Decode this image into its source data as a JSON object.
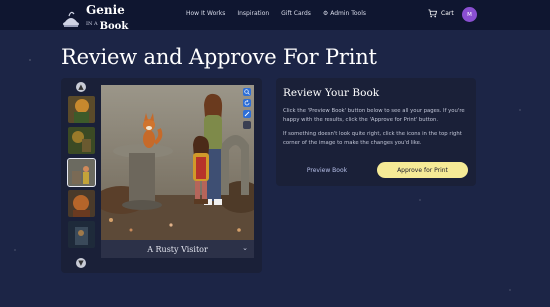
{
  "brand": {
    "title": "Genie",
    "sub": "IN A",
    "book": "Book"
  },
  "nav": {
    "items": [
      "How It Works",
      "Inspiration",
      "Gift Cards",
      "⚙ Admin Tools"
    ]
  },
  "cart": {
    "label": "Cart"
  },
  "user": {
    "initials": "M"
  },
  "page": {
    "title": "Review and Approve For Print"
  },
  "viewer": {
    "caption": "A Rusty Visitor",
    "up_arrow": "▲",
    "down_arrow": "▼",
    "chevron": "⌄",
    "selected_thumb": 3
  },
  "review": {
    "title": "Review Your Book",
    "p1": "Click the 'Preview Book' button below to see all your pages. If you're happy with the results, click the 'Approve for Print' button.",
    "p2": "If something doesn't look quite right, click the icons in the top right corner of the image to make the changes you'd like.",
    "preview_label": "Preview Book",
    "approve_label": "Approve for Print"
  },
  "colors": {
    "accent": "#f5ea96",
    "background": "#1c2546",
    "avatar": "#8a4fd1"
  }
}
